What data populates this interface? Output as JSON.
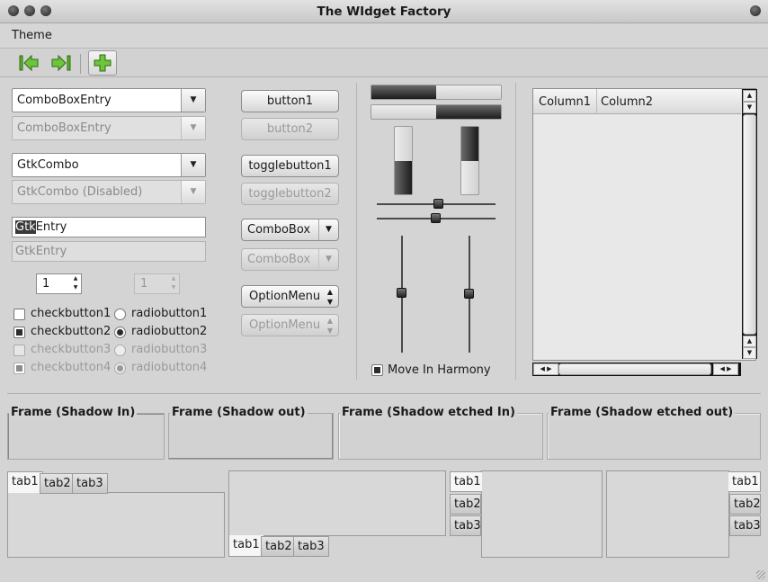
{
  "window": {
    "title": "The WIdget Factory"
  },
  "menubar": {
    "items": [
      "Theme"
    ]
  },
  "toolbar": {
    "buttons": [
      "go-first-icon",
      "go-last-icon",
      "add-icon"
    ],
    "accent": "#5ab22b"
  },
  "col1": {
    "combo_entry": "ComboBoxEntry",
    "combo_entry_disabled": "ComboBoxEntry",
    "gtk_combo": "GtkCombo",
    "gtk_combo_disabled": "GtkCombo (Disabled)",
    "entry_selected": "Gtk",
    "entry_rest": "Entry",
    "entry_disabled": "GtkEntry",
    "spin_value": "1",
    "spin_disabled_value": "1",
    "checks": [
      {
        "label": "checkbutton1",
        "checked": false,
        "disabled": false
      },
      {
        "label": "checkbutton2",
        "checked": true,
        "disabled": false
      },
      {
        "label": "checkbutton3",
        "checked": false,
        "disabled": true
      },
      {
        "label": "checkbutton4",
        "checked": true,
        "disabled": true
      }
    ],
    "radios": [
      {
        "label": "radiobutton1",
        "checked": false,
        "disabled": false
      },
      {
        "label": "radiobutton2",
        "checked": true,
        "disabled": false
      },
      {
        "label": "radiobutton3",
        "checked": false,
        "disabled": true
      },
      {
        "label": "radiobutton4",
        "checked": true,
        "disabled": true
      }
    ]
  },
  "col2": {
    "button1": "button1",
    "button2": "button2",
    "toggle1": "togglebutton1",
    "toggle2": "togglebutton2",
    "combobox": "ComboBox",
    "combobox_disabled": "ComboBox",
    "optionmenu": "OptionMenu",
    "optionmenu_disabled": "OptionMenu"
  },
  "col3": {
    "progress_h": [
      0.5,
      0.5
    ],
    "progress_v": [
      0.5,
      0.5
    ],
    "move_in_harmony": "Move In Harmony",
    "move_in_harmony_checked": true
  },
  "list": {
    "columns": [
      "Column1",
      "Column2"
    ]
  },
  "frames": [
    "Frame (Shadow In)",
    "Frame (Shadow out)",
    "Frame (Shadow etched In)",
    "Frame (Shadow etched out)"
  ],
  "tabs": {
    "labels": [
      "tab1",
      "tab2",
      "tab3"
    ]
  }
}
